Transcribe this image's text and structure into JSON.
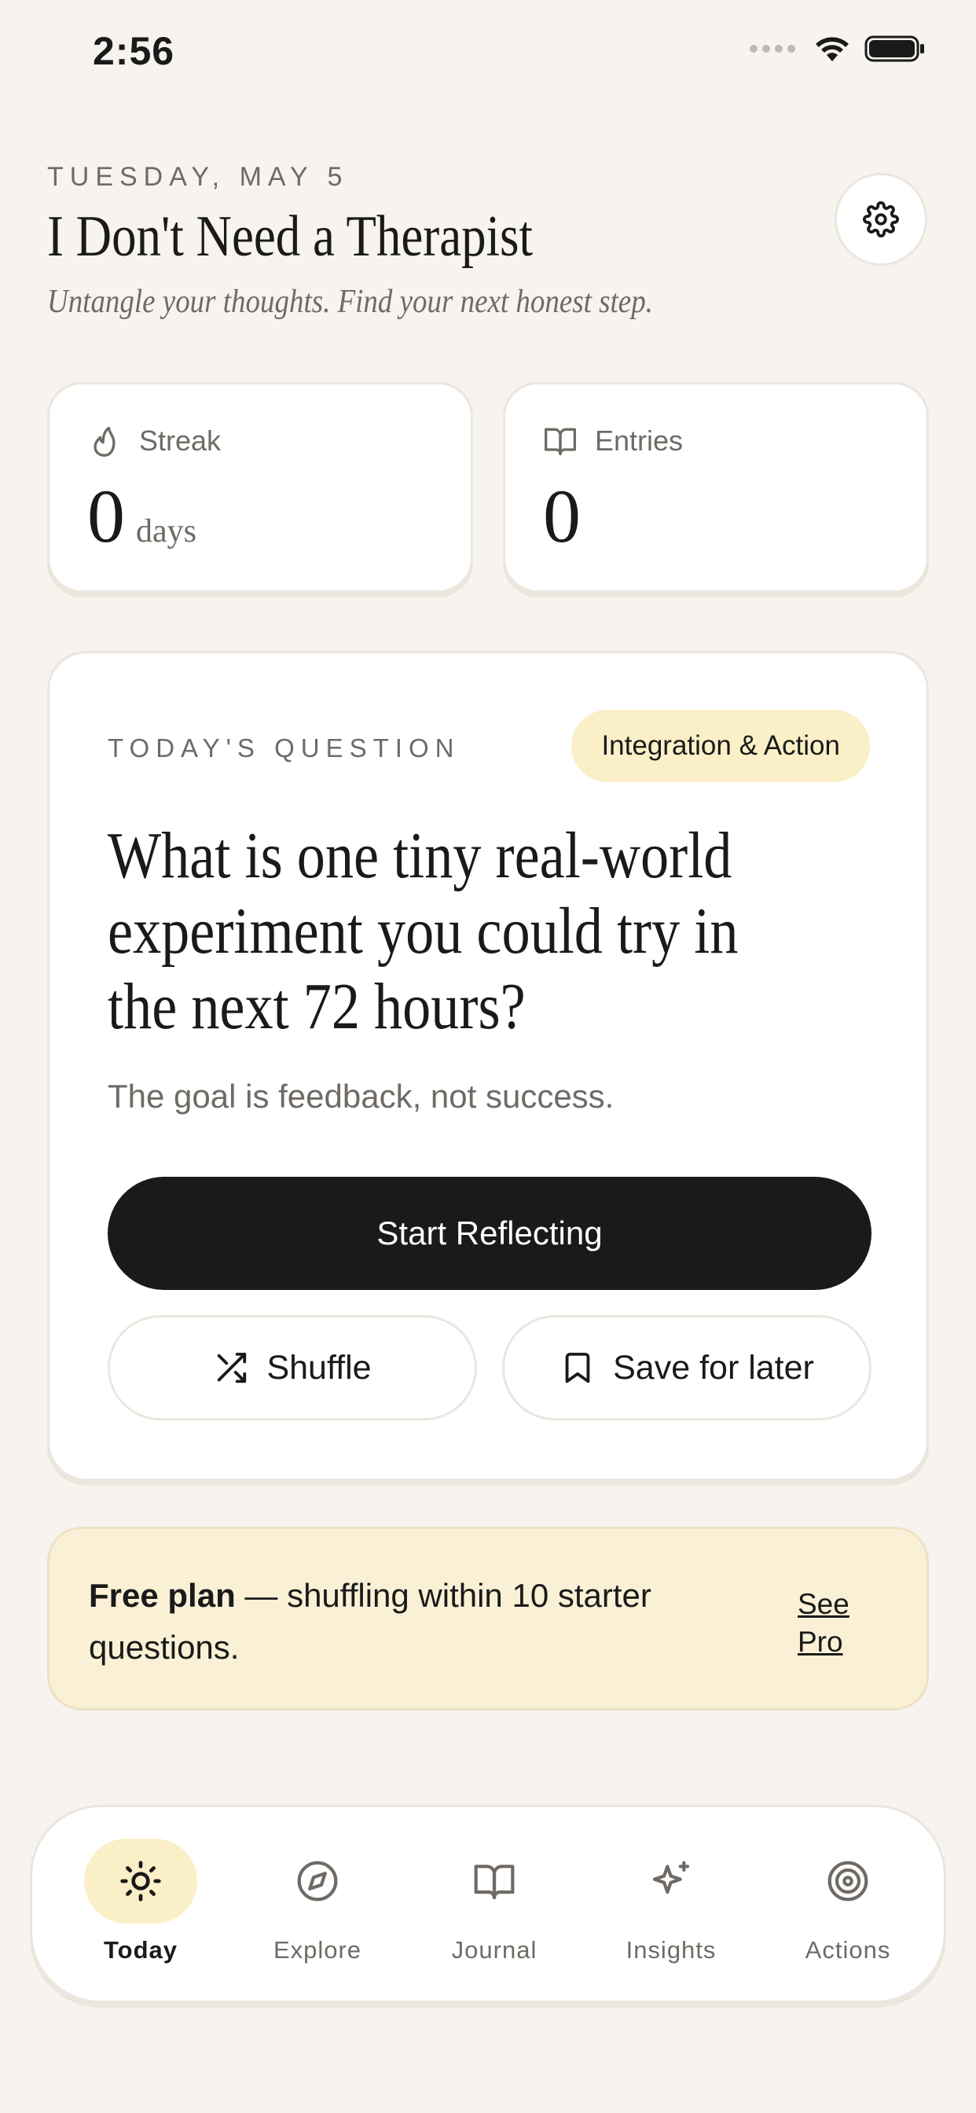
{
  "status": {
    "time": "2:56"
  },
  "header": {
    "date": "TUESDAY, MAY 5",
    "title": "I Don't Need a Therapist",
    "subtitle": "Untangle your thoughts. Find your next honest step."
  },
  "stats": {
    "streak": {
      "label": "Streak",
      "value": "0",
      "unit": "days"
    },
    "entries": {
      "label": "Entries",
      "value": "0"
    }
  },
  "question": {
    "label": "TODAY'S QUESTION",
    "category": "Integration & Action",
    "text": "What is one tiny real-world experiment you could try in the next 72 hours?",
    "hint": "The goal is feedback, not success.",
    "start_label": "Start Reflecting",
    "shuffle_label": "Shuffle",
    "save_label": "Save for later"
  },
  "plan": {
    "bold": "Free plan",
    "text": " — shuffling within 10 starter questions.",
    "link": "See Pro"
  },
  "tabs": [
    {
      "label": "Today",
      "icon": "sun-icon",
      "active": true
    },
    {
      "label": "Explore",
      "icon": "compass-icon",
      "active": false
    },
    {
      "label": "Journal",
      "icon": "book-icon",
      "active": false
    },
    {
      "label": "Insights",
      "icon": "sparkle-icon",
      "active": false
    },
    {
      "label": "Actions",
      "icon": "target-icon",
      "active": false
    }
  ],
  "colors": {
    "accent": "#fbefc8",
    "banner": "#f9f0d6",
    "primary": "#1a1a1a",
    "background": "#f7f3ee"
  }
}
